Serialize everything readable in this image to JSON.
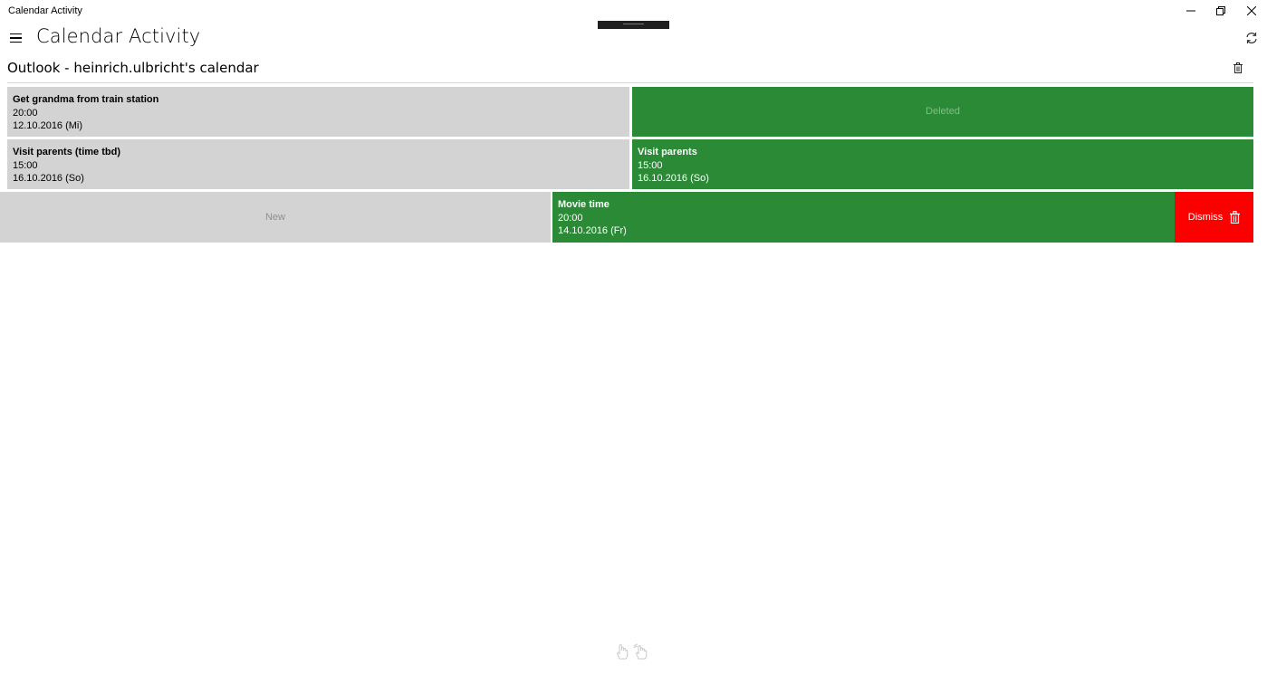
{
  "window": {
    "title": "Calendar Activity",
    "controls": {
      "minimize": "minimize-icon",
      "maximize": "restore-icon",
      "close": "close-icon"
    }
  },
  "header": {
    "menu_icon": "hamburger-icon",
    "title": "Calendar Activity",
    "refresh_icon": "refresh-icon"
  },
  "calendar": {
    "name": "Outlook - heinrich.ulbricht's calendar",
    "delete_icon": "trash-icon"
  },
  "rows": [
    {
      "left": {
        "title": "Get grandma from train station",
        "time": "20:00",
        "date": "12.10.2016 (Mi)"
      },
      "right": {
        "status": "Deleted"
      }
    },
    {
      "left": {
        "title": "Visit parents (time tbd)",
        "time": "15:00",
        "date": "16.10.2016 (So)"
      },
      "right": {
        "title": "Visit parents",
        "time": "15:00",
        "date": "16.10.2016 (So)"
      }
    },
    {
      "left": {
        "status": "New"
      },
      "right": {
        "title": "Movie time",
        "time": "20:00",
        "date": "14.10.2016 (Fr)"
      },
      "action": {
        "label": "Dismiss",
        "icon": "trash-icon"
      }
    }
  ],
  "colors": {
    "gray_card": "#d3d3d3",
    "green_card": "#2b8a36",
    "dismiss_red": "#fc0000"
  },
  "footer": {
    "icons": [
      "touch-hand-icon",
      "touch-gesture-icon"
    ]
  }
}
